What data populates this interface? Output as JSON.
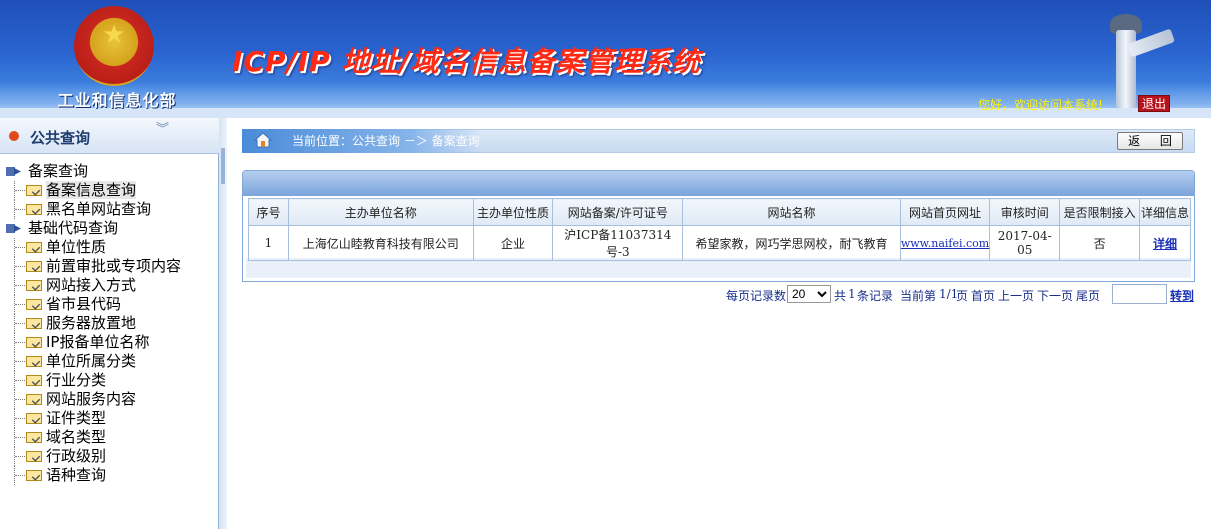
{
  "header": {
    "ministry": "工业和信息化部",
    "title": "ICP/IP 地址/域名信息备案管理系统",
    "welcome": "您好，欢迎访问本系统!",
    "logout": "退出"
  },
  "sidebar": {
    "heading": "公共查询",
    "groups": [
      {
        "label": "备案查询",
        "items": [
          "备案信息查询",
          "黑名单网站查询"
        ]
      },
      {
        "label": "基础代码查询",
        "items": [
          "单位性质",
          "前置审批或专项内容",
          "网站接入方式",
          "省市县代码",
          "服务器放置地",
          "IP报备单位名称",
          "单位所属分类",
          "行业分类",
          "网站服务内容",
          "证件类型",
          "域名类型",
          "行政级别",
          "语种查询"
        ]
      }
    ]
  },
  "breadcrumb": {
    "prefix": "当前位置：",
    "path": "公共查询 －＞ 备案查询"
  },
  "back_button": "返 回",
  "table": {
    "headers": [
      "序号",
      "主办单位名称",
      "主办单位性质",
      "网站备案/许可证号",
      "网站名称",
      "网站首页网址",
      "审核时间",
      "是否限制接入",
      "详细信息"
    ],
    "rows": [
      {
        "no": "1",
        "org": "上海亿山睦教育科技有限公司",
        "type": "企业",
        "license": "沪ICP备11037314号-3",
        "site_name": "希望家教，网巧学思网校，耐飞教育",
        "url": "www.naifei.com",
        "date": "2017-04-05",
        "restricted": "否",
        "detail": "详细"
      }
    ]
  },
  "pager": {
    "per_page_label": "每页记录数",
    "per_page_value": "20",
    "total_prefix": "共",
    "total_count": "1",
    "total_suffix": "条记录",
    "current_prefix": "当前第",
    "current_page": "1/1",
    "current_suffix": "页",
    "first": "首页",
    "prev": "上一页",
    "next": "下一页",
    "last": "尾页",
    "jump": "转到"
  }
}
